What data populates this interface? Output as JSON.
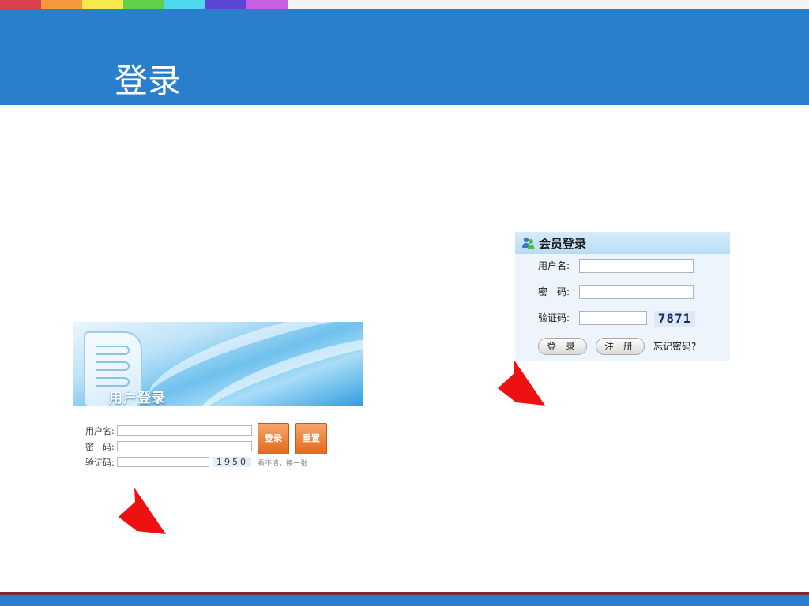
{
  "slide": {
    "title": "登录",
    "strip_colors": [
      "#d9414c",
      "#f29a3d",
      "#f5e94d",
      "#5fd14a",
      "#4cd9ee",
      "#5a45d6",
      "#c65fe0",
      "#ffffff"
    ],
    "header_color": "#2a7fcc",
    "arrow_color": "#ee1111"
  },
  "left_login": {
    "banner_title": "用户登录",
    "username_label": "用户名:",
    "password_label": "密　码:",
    "captcha_label": "验证码:",
    "username_value": "",
    "password_value": "",
    "captcha_value": "",
    "captcha_code": "1950",
    "login_button": "登录",
    "reset_button": "重置",
    "refresh_link": "看不清，换一张",
    "button_color": "#e9742a"
  },
  "right_login": {
    "title": "会员登录",
    "icon": "people-icon",
    "username_label": "用户名:",
    "password_label": "密　码:",
    "captcha_label": "验证码:",
    "username_value": "",
    "password_value": "",
    "captcha_value": "",
    "captcha_code": "7871",
    "login_button": "登 录",
    "register_button": "注 册",
    "forgot_link": "忘记密码?"
  }
}
